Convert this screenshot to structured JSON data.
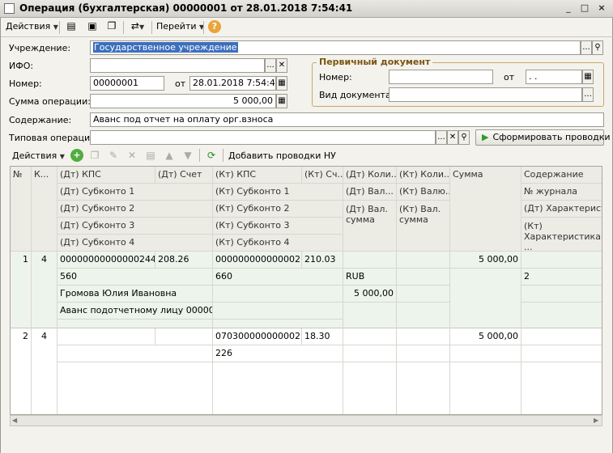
{
  "window": {
    "title": "Операция (бухгалтерская) 00000001 от 28.01.2018 7:54:41",
    "controls": [
      "_",
      "□",
      "×"
    ]
  },
  "toolbar": {
    "actions_label": "Действия",
    "goto_label": "Перейти",
    "help_symbol": "?"
  },
  "form": {
    "institution_label": "Учреждение:",
    "institution_value": "Государственное учреждение",
    "ifo_label": "ИФО:",
    "ifo_value": "",
    "number_label": "Номер:",
    "number_value": "00000001",
    "from_label": "от",
    "date_value": "28.01.2018 7:54:41",
    "amount_label": "Сумма операции:",
    "amount_value": "5 000,00",
    "content_label": "Содержание:",
    "content_value": "Аванс под отчет на оплату орг.взноса",
    "typical_label": "Типовая операция:",
    "typical_value": "",
    "generate_button": "Сформировать проводки"
  },
  "primary_doc": {
    "title": "Первичный документ",
    "number_label": "Номер:",
    "number_value": "",
    "from_label": "от",
    "date_value": " .  . ",
    "kind_label": "Вид документа:",
    "kind_value": ""
  },
  "grid_toolbar": {
    "actions_label": "Действия",
    "add_nu_label": "Добавить проводки НУ"
  },
  "grid": {
    "header": {
      "num": "№",
      "k": "К...",
      "dt_kps": "(Дт) КПС",
      "dt_account": "(Дт) Счет",
      "kt_kps": "(Кт) КПС",
      "kt_account": "(Кт) Сч...",
      "dt_qty": "(Дт) Коли...",
      "kt_qty": "(Кт) Коли...",
      "sum": "Сумма",
      "content": "Содержание",
      "dt_sub1": "(Дт) Субконто 1",
      "kt_sub1": "(Кт) Субконто 1",
      "dt_val": "(Дт) Вал...",
      "kt_val": "(Кт) Валю...",
      "journal": "№ журнала",
      "dt_sub2": "(Дт) Субконто 2",
      "kt_sub2": "(Кт) Субконто 2",
      "dt_val_sum": "(Дт) Вал. сумма",
      "kt_val_sum": "(Кт) Вал. сумма",
      "dt_char": "(Дт) Характерист...",
      "dt_sub3": "(Дт) Субконто 3",
      "kt_sub3": "(Кт) Субконто 3",
      "kt_char": "(Кт) Характеристика ...",
      "dt_sub4": "(Дт) Субконто 4",
      "kt_sub4": "(Кт) Субконто 4"
    },
    "rows": [
      {
        "num": "1",
        "k": "4",
        "dt_kps": "00000000000000244",
        "dt_account": "208.26",
        "kt_kps": "000000000000002...",
        "kt_account": "210.03",
        "sum": "5 000,00",
        "dt_sub1": "560",
        "kt_sub1": "660",
        "dt_currency": "RUB",
        "journal": "2",
        "dt_sub2": "Громова Юлия Ивановна",
        "dt_val_sum": "5 000,00",
        "dt_sub3": "Аванс подотчетному лицу 0000000..."
      },
      {
        "num": "2",
        "k": "4",
        "dt_kps": "",
        "dt_account": "",
        "kt_kps": "070300000000002...",
        "kt_account": "18.30",
        "sum": "5 000,00",
        "kt_sub1": "226"
      }
    ]
  }
}
